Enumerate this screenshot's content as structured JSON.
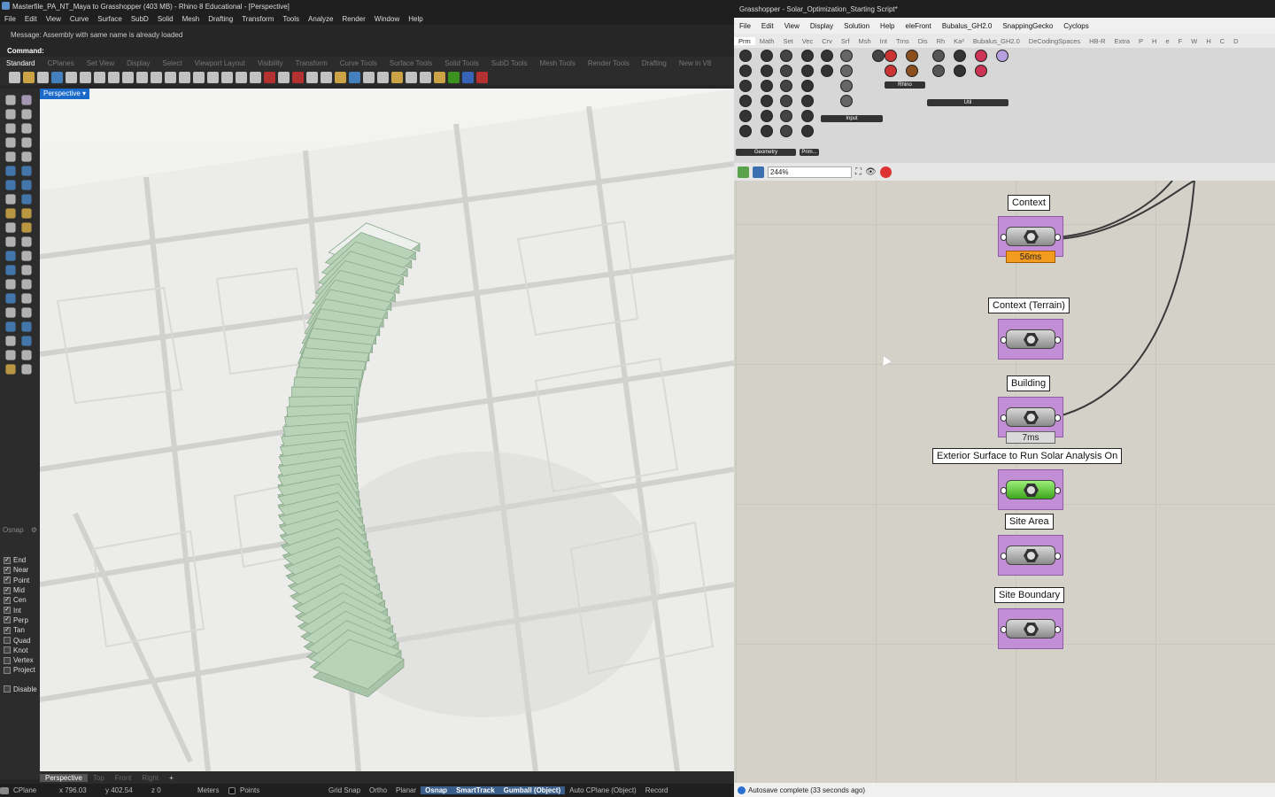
{
  "rhino": {
    "title": "Masterfile_PA_NT_Maya to Grasshopper (403 MB) - Rhino 8 Educational - [Perspective]",
    "menu": [
      "File",
      "Edit",
      "View",
      "Curve",
      "Surface",
      "SubD",
      "Solid",
      "Mesh",
      "Drafting",
      "Transform",
      "Tools",
      "Analyze",
      "Render",
      "Window",
      "Help"
    ],
    "message": "Message: Assembly with same name is already loaded",
    "command": "Command:",
    "tabs": [
      "Standard",
      "CPlanes",
      "Set View",
      "Display",
      "Select",
      "Viewport Layout",
      "Visibility",
      "Transform",
      "Curve Tools",
      "Surface Tools",
      "Solid Tools",
      "SubD Tools",
      "Mesh Tools",
      "Render Tools",
      "Drafting",
      "New in V8"
    ],
    "viewport_label": "Perspective",
    "viewport_tabs": [
      "Perspective",
      "Top",
      "Front",
      "Right"
    ],
    "osnap": {
      "header": "Osnap",
      "items": [
        {
          "label": "End",
          "checked": true
        },
        {
          "label": "Near",
          "checked": true
        },
        {
          "label": "Point",
          "checked": true
        },
        {
          "label": "Mid",
          "checked": true
        },
        {
          "label": "Cen",
          "checked": true
        },
        {
          "label": "Int",
          "checked": true
        },
        {
          "label": "Perp",
          "checked": true
        },
        {
          "label": "Tan",
          "checked": true
        },
        {
          "label": "Quad",
          "checked": false
        },
        {
          "label": "Knot",
          "checked": false
        },
        {
          "label": "Vertex",
          "checked": false
        },
        {
          "label": "Project",
          "checked": false
        }
      ],
      "disable": "Disable"
    },
    "status": {
      "cplane": "CPlane",
      "x": "x 796.03",
      "y": "y 402.54",
      "z": "z 0",
      "units": "Meters",
      "layer": "Points",
      "toggles": [
        {
          "label": "Grid Snap",
          "on": false
        },
        {
          "label": "Ortho",
          "on": false
        },
        {
          "label": "Planar",
          "on": false
        },
        {
          "label": "Osnap",
          "on": true
        },
        {
          "label": "SmartTrack",
          "on": true
        },
        {
          "label": "Gumball (Object)",
          "on": true
        },
        {
          "label": "Auto CPlane (Object)",
          "on": false
        },
        {
          "label": "Record",
          "on": false
        }
      ]
    }
  },
  "grasshopper": {
    "title": "Grasshopper - Solar_Optimization_Starting Script*",
    "menu": [
      "File",
      "Edit",
      "View",
      "Display",
      "Solution",
      "Help",
      "eleFront",
      "Bubalus_GH2.0",
      "SnappingGecko",
      "Cyclops"
    ],
    "tabs": [
      "Prm",
      "Math",
      "Set",
      "Vec",
      "Crv",
      "Srf",
      "Msh",
      "Int",
      "Trns",
      "Dis",
      "Rh",
      "Ka²",
      "Bubalus_GH2.0",
      "DeCodingSpaces",
      "HB-R",
      "Extra",
      "P",
      "H",
      "e",
      "F",
      "W",
      "H",
      "C",
      "D"
    ],
    "panels": [
      "Geometry",
      "Prim...",
      "Input",
      "Rhino",
      "Util"
    ],
    "zoom": "244%",
    "nodes": [
      {
        "label": "Context",
        "timing": "56ms",
        "style": "orange"
      },
      {
        "label": "Context (Terrain)",
        "timing": "",
        "style": ""
      },
      {
        "label": "Building",
        "timing": "7ms",
        "style": "grey"
      },
      {
        "label": "Exterior Surface to Run Solar Analysis On",
        "timing": "",
        "style": "green"
      },
      {
        "label": "Site Area",
        "timing": "",
        "style": ""
      },
      {
        "label": "Site Boundary",
        "timing": "",
        "style": ""
      }
    ],
    "status": "Autosave complete (33 seconds ago)"
  }
}
